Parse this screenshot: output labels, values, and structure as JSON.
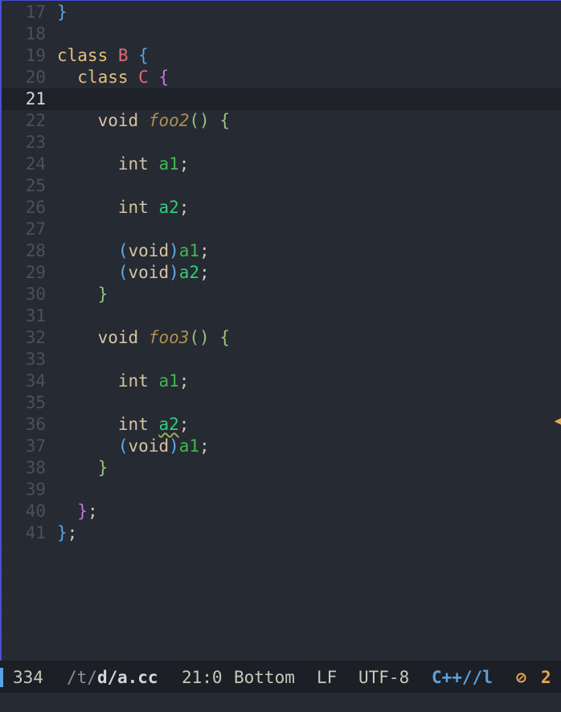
{
  "editor": {
    "lines": [
      {
        "num": "17",
        "segs": [
          {
            "t": "}",
            "c": "brace-blue"
          }
        ]
      },
      {
        "num": "18",
        "segs": []
      },
      {
        "num": "19",
        "segs": [
          {
            "t": "class ",
            "c": "kw"
          },
          {
            "t": "B",
            "c": "cls-red"
          },
          {
            "t": " {",
            "c": "brace-blue"
          }
        ]
      },
      {
        "num": "20",
        "segs": [
          {
            "t": "  class ",
            "c": "kw2"
          },
          {
            "t": "C",
            "c": "cls-red"
          },
          {
            "t": " {",
            "c": "brace-pink"
          }
        ]
      },
      {
        "num": "21",
        "segs": [],
        "current": true
      },
      {
        "num": "22",
        "segs": [
          {
            "t": "    void ",
            "c": "ty"
          },
          {
            "t": "foo2",
            "c": "fn"
          },
          {
            "t": "()",
            "c": "brace-green"
          },
          {
            "t": " {",
            "c": "brace-green"
          }
        ]
      },
      {
        "num": "23",
        "segs": []
      },
      {
        "num": "24",
        "segs": [
          {
            "t": "      int ",
            "c": "ty"
          },
          {
            "t": "a1",
            "c": "var"
          },
          {
            "t": ";",
            "c": "punct"
          }
        ]
      },
      {
        "num": "25",
        "segs": []
      },
      {
        "num": "26",
        "segs": [
          {
            "t": "      int ",
            "c": "ty"
          },
          {
            "t": "a2",
            "c": "var2"
          },
          {
            "t": ";",
            "c": "punct"
          }
        ]
      },
      {
        "num": "27",
        "segs": []
      },
      {
        "num": "28",
        "segs": [
          {
            "t": "      (",
            "c": "paren-blue"
          },
          {
            "t": "void",
            "c": "ty"
          },
          {
            "t": ")",
            "c": "paren-blue"
          },
          {
            "t": "a1",
            "c": "var"
          },
          {
            "t": ";",
            "c": "punct"
          }
        ]
      },
      {
        "num": "29",
        "segs": [
          {
            "t": "      (",
            "c": "paren-blue"
          },
          {
            "t": "void",
            "c": "ty"
          },
          {
            "t": ")",
            "c": "paren-blue"
          },
          {
            "t": "a2",
            "c": "var2"
          },
          {
            "t": ";",
            "c": "punct"
          }
        ]
      },
      {
        "num": "30",
        "segs": [
          {
            "t": "    }",
            "c": "brace-green"
          }
        ]
      },
      {
        "num": "31",
        "segs": []
      },
      {
        "num": "32",
        "segs": [
          {
            "t": "    void ",
            "c": "ty"
          },
          {
            "t": "foo3",
            "c": "fn"
          },
          {
            "t": "()",
            "c": "brace-green"
          },
          {
            "t": " {",
            "c": "brace-green"
          }
        ]
      },
      {
        "num": "33",
        "segs": []
      },
      {
        "num": "34",
        "segs": [
          {
            "t": "      int ",
            "c": "ty"
          },
          {
            "t": "a1",
            "c": "var"
          },
          {
            "t": ";",
            "c": "punct"
          }
        ]
      },
      {
        "num": "35",
        "segs": []
      },
      {
        "num": "36",
        "segs": [
          {
            "t": "      int ",
            "c": "ty"
          },
          {
            "t": "a2",
            "c": "var2 squig"
          },
          {
            "t": ";",
            "c": "punct"
          }
        ]
      },
      {
        "num": "37",
        "segs": [
          {
            "t": "      (",
            "c": "paren-blue"
          },
          {
            "t": "void",
            "c": "ty"
          },
          {
            "t": ")",
            "c": "paren-blue"
          },
          {
            "t": "a1",
            "c": "var"
          },
          {
            "t": ";",
            "c": "punct"
          }
        ]
      },
      {
        "num": "38",
        "segs": [
          {
            "t": "    }",
            "c": "brace-green"
          }
        ]
      },
      {
        "num": "39",
        "segs": []
      },
      {
        "num": "40",
        "segs": [
          {
            "t": "  }",
            "c": "brace-pink"
          },
          {
            "t": ";",
            "c": "punct"
          }
        ]
      },
      {
        "num": "41",
        "segs": [
          {
            "t": "}",
            "c": "brace-blue"
          },
          {
            "t": ";",
            "c": "punct"
          }
        ]
      }
    ]
  },
  "modeline": {
    "size": "334",
    "path_dir_t": "/t/",
    "path_dir_d": "d/",
    "file_name": "a.cc",
    "position": "21:0",
    "scroll": "Bottom",
    "eol": "LF",
    "encoding": "UTF-8",
    "mode": "C++//l",
    "error_count": "2"
  },
  "colors": {
    "background": "#262a33",
    "current_line": "#1e2128",
    "accent": "#4a4fd6",
    "error": "#e5a64e"
  }
}
